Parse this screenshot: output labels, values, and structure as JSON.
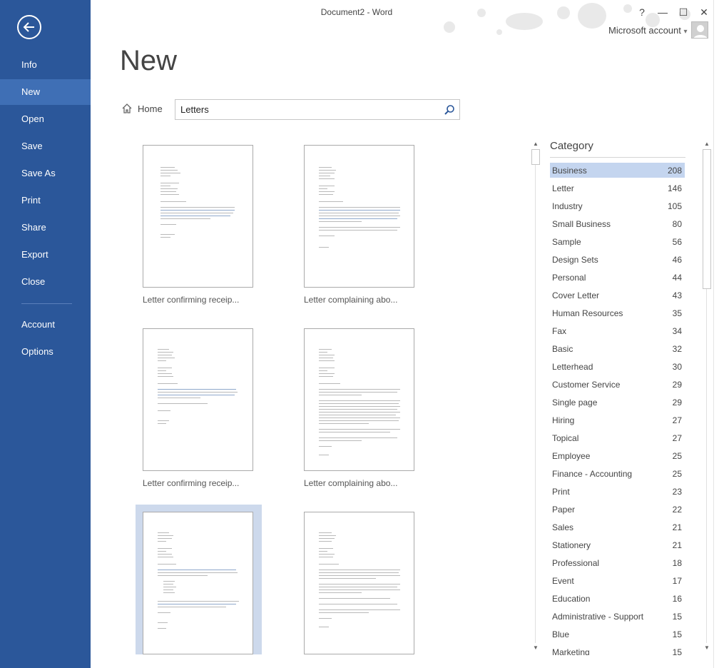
{
  "window": {
    "title": "Document2 - Word",
    "help": "?",
    "minimize": "—",
    "maximize": "☐",
    "close": "✕",
    "account_label": "Microsoft account",
    "account_caret": "▾"
  },
  "nav": {
    "items": [
      {
        "label": "Info"
      },
      {
        "label": "New"
      },
      {
        "label": "Open"
      },
      {
        "label": "Save"
      },
      {
        "label": "Save As"
      },
      {
        "label": "Print"
      },
      {
        "label": "Share"
      },
      {
        "label": "Export"
      },
      {
        "label": "Close"
      },
      {
        "label": "Account"
      },
      {
        "label": "Options"
      }
    ],
    "active": "New"
  },
  "main": {
    "heading": "New",
    "home_label": "Home",
    "search_value": "Letters",
    "templates": [
      {
        "caption": "Letter confirming receip..."
      },
      {
        "caption": "Letter complaining abo..."
      },
      {
        "caption": "Letter confirming receip..."
      },
      {
        "caption": "Letter complaining abo..."
      },
      {
        "caption": ""
      },
      {
        "caption": ""
      }
    ]
  },
  "category": {
    "title": "Category",
    "items": [
      {
        "name": "Business",
        "count": "208"
      },
      {
        "name": "Letter",
        "count": "146"
      },
      {
        "name": "Industry",
        "count": "105"
      },
      {
        "name": "Small Business",
        "count": "80"
      },
      {
        "name": "Sample",
        "count": "56"
      },
      {
        "name": "Design Sets",
        "count": "46"
      },
      {
        "name": "Personal",
        "count": "44"
      },
      {
        "name": "Cover Letter",
        "count": "43"
      },
      {
        "name": "Human Resources",
        "count": "35"
      },
      {
        "name": "Fax",
        "count": "34"
      },
      {
        "name": "Basic",
        "count": "32"
      },
      {
        "name": "Letterhead",
        "count": "30"
      },
      {
        "name": "Customer Service",
        "count": "29"
      },
      {
        "name": "Single page",
        "count": "29"
      },
      {
        "name": "Hiring",
        "count": "27"
      },
      {
        "name": "Topical",
        "count": "27"
      },
      {
        "name": "Employee",
        "count": "25"
      },
      {
        "name": "Finance - Accounting",
        "count": "25"
      },
      {
        "name": "Print",
        "count": "23"
      },
      {
        "name": "Paper",
        "count": "22"
      },
      {
        "name": "Sales",
        "count": "21"
      },
      {
        "name": "Stationery",
        "count": "21"
      },
      {
        "name": "Professional",
        "count": "18"
      },
      {
        "name": "Event",
        "count": "17"
      },
      {
        "name": "Education",
        "count": "16"
      },
      {
        "name": "Administrative - Support",
        "count": "15"
      },
      {
        "name": "Blue",
        "count": "15"
      },
      {
        "name": "Marketing",
        "count": "15"
      }
    ],
    "selected": "Business"
  },
  "colors": {
    "nav_bg": "#2b579a",
    "nav_active": "#3f6fb5",
    "selected_category": "#c4d5ef",
    "selected_template": "#cdd9ec"
  },
  "icons": {
    "back": "back-arrow-icon",
    "home": "home-icon",
    "search": "search-icon",
    "avatar": "user-avatar-icon"
  }
}
